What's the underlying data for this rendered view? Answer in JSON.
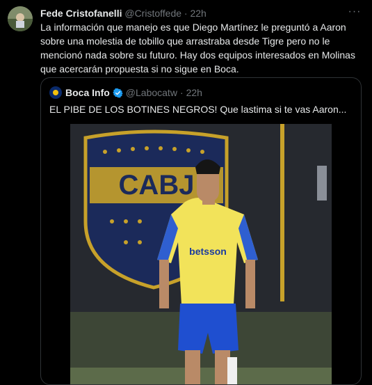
{
  "tweet": {
    "author_name": "Fede Cristofanelli",
    "handle": "@Cristoffede",
    "separator": "·",
    "time": "22h",
    "more_label": "···",
    "text": "La información que manejo es que Diego Martínez le preguntó a Aaron sobre una molestia de tobillo que arrastraba desde Tigre pero no le mencionó nada sobre su futuro. Hay dos equipos interesados en Molinas que acercarán propuesta si no sigue en Boca."
  },
  "quote": {
    "author_name": "Boca Info",
    "handle": "@Labocatw",
    "separator": "·",
    "time": "22h",
    "text": "EL PIBE DE LOS BOTINES NEGROS! Que lastima si te vas Aaron..."
  },
  "media": {
    "crest_text": "CABJ",
    "shirt_sponsor": "betsson"
  },
  "colors": {
    "background": "#000000",
    "text": "#e7e9ea",
    "muted": "#71767b",
    "border": "#2f3336",
    "verified": "#1d9bf0",
    "boca_blue": "#0a2a6b",
    "boca_yellow": "#f2c10d"
  }
}
